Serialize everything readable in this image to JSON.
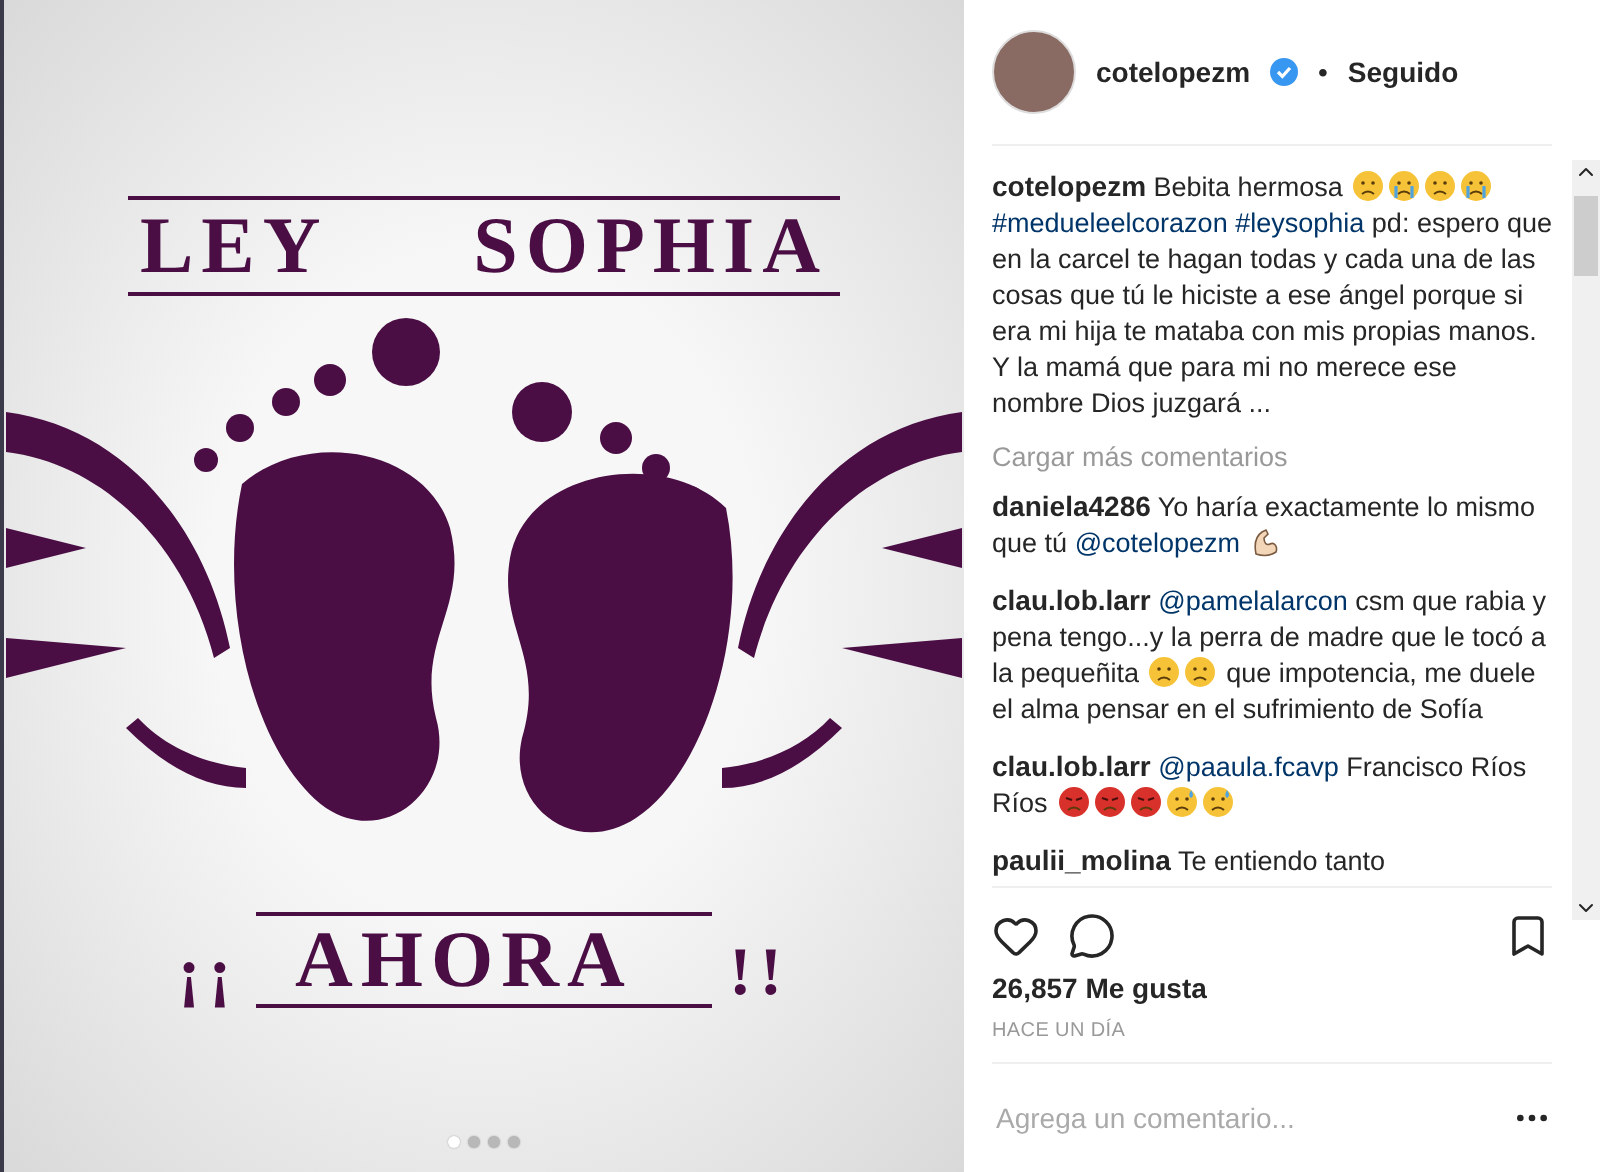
{
  "post_image": {
    "headline": [
      "LEY",
      "SOPHIA"
    ],
    "footer": [
      "¡¡",
      "AHORA",
      "!!"
    ],
    "dots": [
      {
        "selected": true
      },
      {
        "selected": false
      },
      {
        "selected": false
      },
      {
        "selected": false
      }
    ]
  },
  "header": {
    "username": "cotelopezm",
    "verified": true,
    "separator": "•",
    "follow_status": "Seguido"
  },
  "caption": {
    "username": "cotelopezm",
    "parts": [
      {
        "kind": "text",
        "text": "Bebita hermosa"
      },
      {
        "kind": "sad"
      },
      {
        "kind": "crying"
      },
      {
        "kind": "sad"
      },
      {
        "kind": "crying"
      },
      {
        "kind": "hashtag",
        "text": "#medueleelcorazon"
      },
      {
        "kind": "hashtag",
        "text": "#leysophia"
      },
      {
        "kind": "text",
        "text": "pd: espero que en la carcel te hagan todas y cada una de las cosas que tú le hiciste a ese ángel porque si era mi hija te mataba con mis propias manos. Y la mamá que para mi no merece ese nombre Dios juzgará ..."
      }
    ]
  },
  "load_more": "Cargar más comentarios",
  "comments": [
    {
      "username": "daniela4286",
      "parts": [
        {
          "kind": "text",
          "text": "Yo haría exactamente lo mismo que tú"
        },
        {
          "kind": "mention",
          "text": "@cotelopezm"
        },
        {
          "kind": "arm"
        }
      ]
    },
    {
      "username": "clau.lob.larr",
      "parts": [
        {
          "kind": "mention",
          "text": "@pamelalarcon"
        },
        {
          "kind": "text",
          "text": "csm que rabia y pena tengo...y la perra de madre que le tocó a la pequeñita"
        },
        {
          "kind": "sad"
        },
        {
          "kind": "sad"
        },
        {
          "kind": "text",
          "text": "que impotencia, me duele el alma pensar en el sufrimiento de Sofía"
        }
      ]
    },
    {
      "username": "clau.lob.larr",
      "parts": [
        {
          "kind": "mention",
          "text": "@paaula.fcavp"
        },
        {
          "kind": "text",
          "text": "Francisco Ríos Ríos"
        },
        {
          "kind": "angry"
        },
        {
          "kind": "angry"
        },
        {
          "kind": "angry"
        },
        {
          "kind": "sweat"
        },
        {
          "kind": "sweat"
        }
      ]
    },
    {
      "username": "paulii_molina",
      "parts": [
        {
          "kind": "text",
          "text": "Te entiendo tanto"
        }
      ]
    }
  ],
  "likes": "26,857 Me gusta",
  "time": "HACE UN DÍA",
  "add_comment": {
    "placeholder": "Agrega un comentario..."
  }
}
